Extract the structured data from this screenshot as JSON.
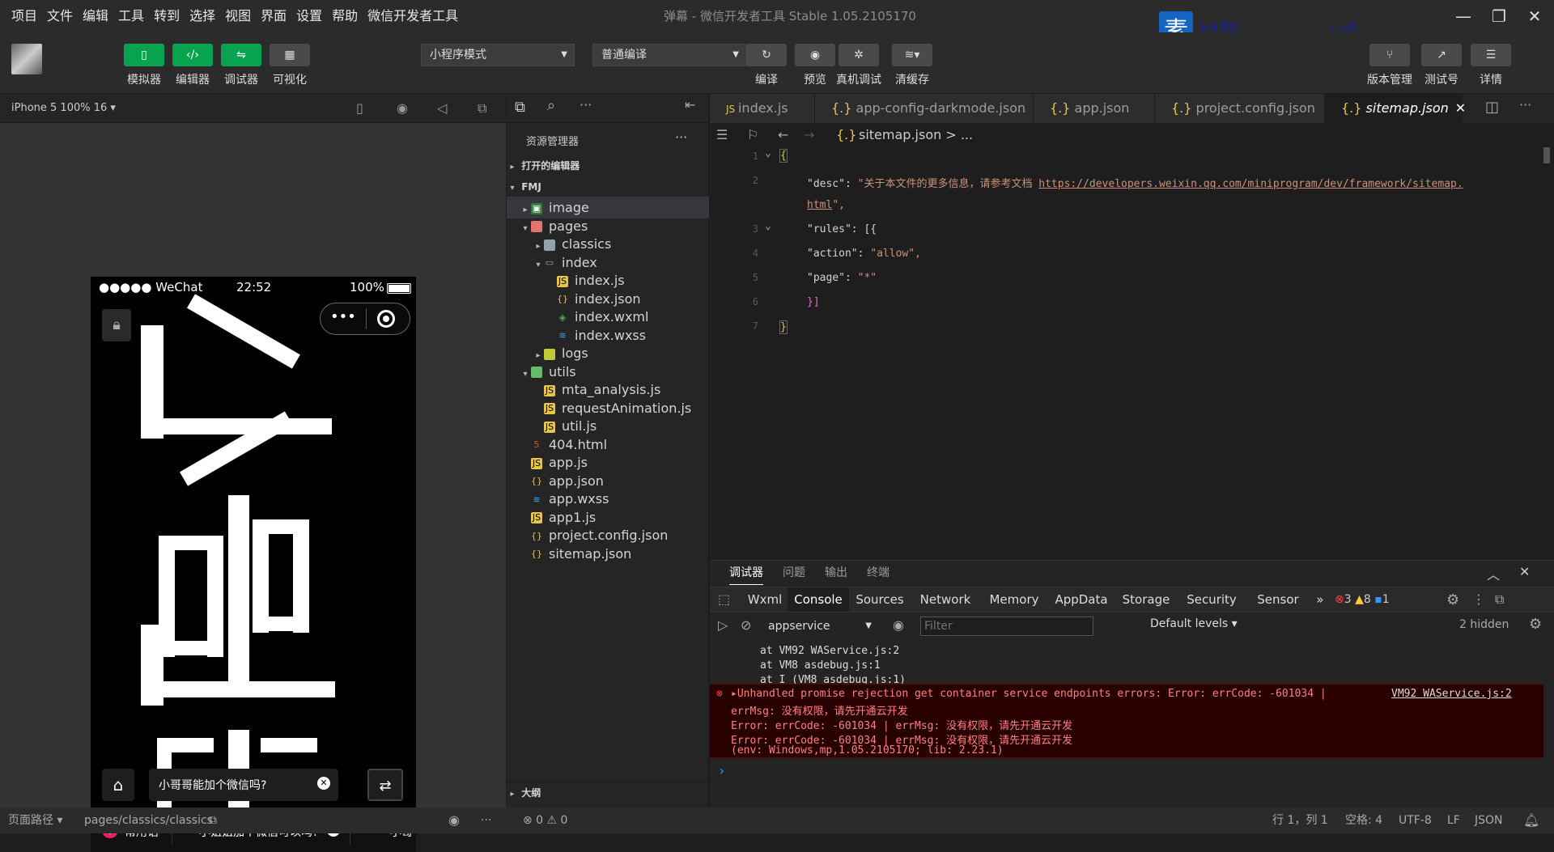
{
  "menubar": {
    "items": [
      "项目",
      "文件",
      "编辑",
      "工具",
      "转到",
      "选择",
      "视图",
      "界面",
      "设置",
      "帮助",
      "微信开发者工具"
    ],
    "title": "弹幕 - 微信开发者工具 Stable 1.05.2105170",
    "watermark_text": "素材熟",
    "watermark_url": "sucaire.com"
  },
  "toolbar": {
    "simulator": "模拟器",
    "editor": "编辑器",
    "debugger": "调试器",
    "visual": "可视化",
    "mode": "小程序模式",
    "compile_mode": "普通编译",
    "compile": "编译",
    "preview": "预览",
    "remote_debug": "真机调试",
    "clear_cache": "清缓存",
    "version": "版本管理",
    "test": "测试号",
    "details": "详情"
  },
  "simulator": {
    "device": "iPhone 5 100% 16 ▾",
    "carrier": "●●●●● WeChat",
    "time": "22:52",
    "battery": "100%",
    "input_text": "小哥哥能加个微信吗?",
    "phrase_label": "常用语",
    "chip1": "小姐姐加个微信可以吗?",
    "chip2": "小哥"
  },
  "explorer": {
    "title": "资源管理器",
    "open_editors": "打开的编辑器",
    "project": "FMJ",
    "outline": "大纲",
    "tree": [
      {
        "label": "image",
        "depth": 1,
        "arrow": "▸",
        "icon": "img",
        "sel": true
      },
      {
        "label": "pages",
        "depth": 1,
        "arrow": "▾",
        "icon": "folder-red"
      },
      {
        "label": "classics",
        "depth": 2,
        "arrow": "▸",
        "icon": "folder"
      },
      {
        "label": "index",
        "depth": 2,
        "arrow": "▾",
        "icon": "folder-open"
      },
      {
        "label": "index.js",
        "depth": 3,
        "arrow": "",
        "icon": "js"
      },
      {
        "label": "index.json",
        "depth": 3,
        "arrow": "",
        "icon": "json"
      },
      {
        "label": "index.wxml",
        "depth": 3,
        "arrow": "",
        "icon": "wxml"
      },
      {
        "label": "index.wxss",
        "depth": 3,
        "arrow": "",
        "icon": "wxss"
      },
      {
        "label": "logs",
        "depth": 2,
        "arrow": "▸",
        "icon": "folder-y"
      },
      {
        "label": "utils",
        "depth": 1,
        "arrow": "▾",
        "icon": "folder-g"
      },
      {
        "label": "mta_analysis.js",
        "depth": 2,
        "arrow": "",
        "icon": "js"
      },
      {
        "label": "requestAnimation.js",
        "depth": 2,
        "arrow": "",
        "icon": "js"
      },
      {
        "label": "util.js",
        "depth": 2,
        "arrow": "",
        "icon": "js"
      },
      {
        "label": "404.html",
        "depth": 1,
        "arrow": "",
        "icon": "html"
      },
      {
        "label": "app.js",
        "depth": 1,
        "arrow": "",
        "icon": "js"
      },
      {
        "label": "app.json",
        "depth": 1,
        "arrow": "",
        "icon": "json"
      },
      {
        "label": "app.wxss",
        "depth": 1,
        "arrow": "",
        "icon": "wxss"
      },
      {
        "label": "app1.js",
        "depth": 1,
        "arrow": "",
        "icon": "js"
      },
      {
        "label": "project.config.json",
        "depth": 1,
        "arrow": "",
        "icon": "json"
      },
      {
        "label": "sitemap.json",
        "depth": 1,
        "arrow": "",
        "icon": "json"
      }
    ]
  },
  "tabs": [
    "index.js",
    "app-config-darkmode.json",
    "app.json",
    "project.config.json",
    "sitemap.json"
  ],
  "breadcrumb": "sitemap.json > ...",
  "code": {
    "l1": "{",
    "desc_key": "\"desc\": ",
    "desc_val": "\"关于本文件的更多信息，请参考文档 ",
    "desc_url": "https://developers.weixin.qq.com/miniprogram/dev/framework/sitemap.",
    "desc_url2": "html",
    "desc_end": "\",",
    "rules": "\"rules\": [{",
    "action_key": "\"action\": ",
    "action_val": "\"allow\",",
    "page_key": "\"page\": ",
    "page_val": "\"*\"",
    "close_rules": "}]",
    "close": "}",
    "line_numbers": [
      "1",
      "2",
      "3",
      "4",
      "5",
      "6",
      "7"
    ]
  },
  "devtools": {
    "top_tabs": [
      "调试器",
      "问题",
      "输出",
      "终端"
    ],
    "panels": [
      "Wxml",
      "Console",
      "Sources",
      "Network",
      "Memory",
      "AppData",
      "Storage",
      "Security",
      "Sensor"
    ],
    "errors": "3",
    "warnings": "8",
    "infos": "1",
    "context": "appservice",
    "filter_placeholder": "Filter",
    "levels": "Default levels ▾",
    "hidden": "2 hidden",
    "stack1": "at VM92 WAService.js:2",
    "stack2": "at VM8 asdebug.js:1",
    "stack3": "at I (VM8 asdebug.js:1)",
    "err1": "▸Unhandled promise rejection get container service endpoints errors: Error: errCode: -601034  |",
    "err_link": "VM92 WAService.js:2",
    "err2": "errMsg: 没有权限，请先开通云开发",
    "err3": "Error: errCode: -601034  | errMsg: 没有权限，请先开通云开发",
    "err4": "Error: errCode: -601034  | errMsg: 没有权限，请先开通云开发",
    "err5": "(env: Windows,mp,1.05.2105170; lib: 2.23.1)",
    "prompt": "›"
  },
  "status": {
    "path_label": "页面路径 ▾",
    "path": "pages/classics/classics",
    "problems": "⊗ 0 ⚠ 0",
    "position": "行 1，列 1",
    "spaces": "空格: 4",
    "encoding": "UTF-8",
    "eol": "LF",
    "lang": "JSON"
  }
}
